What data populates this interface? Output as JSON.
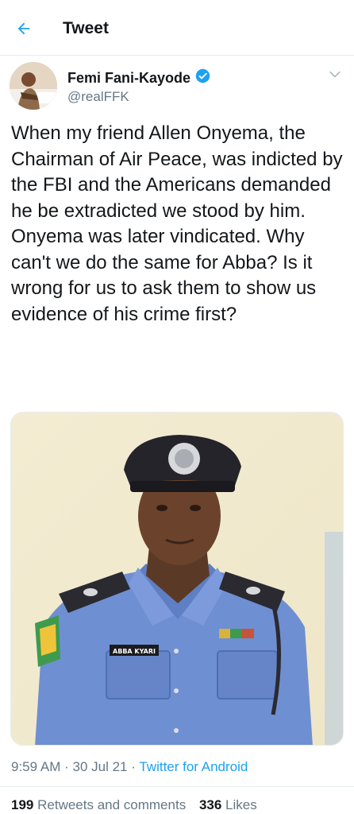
{
  "header": {
    "title": "Tweet",
    "back_icon": "back-arrow-icon"
  },
  "colors": {
    "accent": "#1da1f2",
    "text": "#14171a",
    "secondary": "#657786",
    "border": "#e6ecf0"
  },
  "tweet": {
    "author_name": "Femi Fani-Kayode",
    "verified_icon": "verified-badge-icon",
    "handle": "@realFFK",
    "menu_icon": "chevron-down-icon",
    "text": "When my friend Allen Onyema, the Chairman of Air Peace, was indicted by the FBI and the Americans demanded he be extradicted we stood by him. Onyema was later vindicated. Why can't we do the same for Abba? Is it wrong for us to ask them to show us evidence of his crime first?",
    "image": {
      "name_tag": "ABBA KYARI"
    },
    "time": "9:59 AM",
    "separator": "·",
    "date": "30 Jul 21",
    "source": "Twitter for Android",
    "retweets_count": "199",
    "retweets_label": "Retweets and comments",
    "likes_count": "336",
    "likes_label": "Likes"
  }
}
